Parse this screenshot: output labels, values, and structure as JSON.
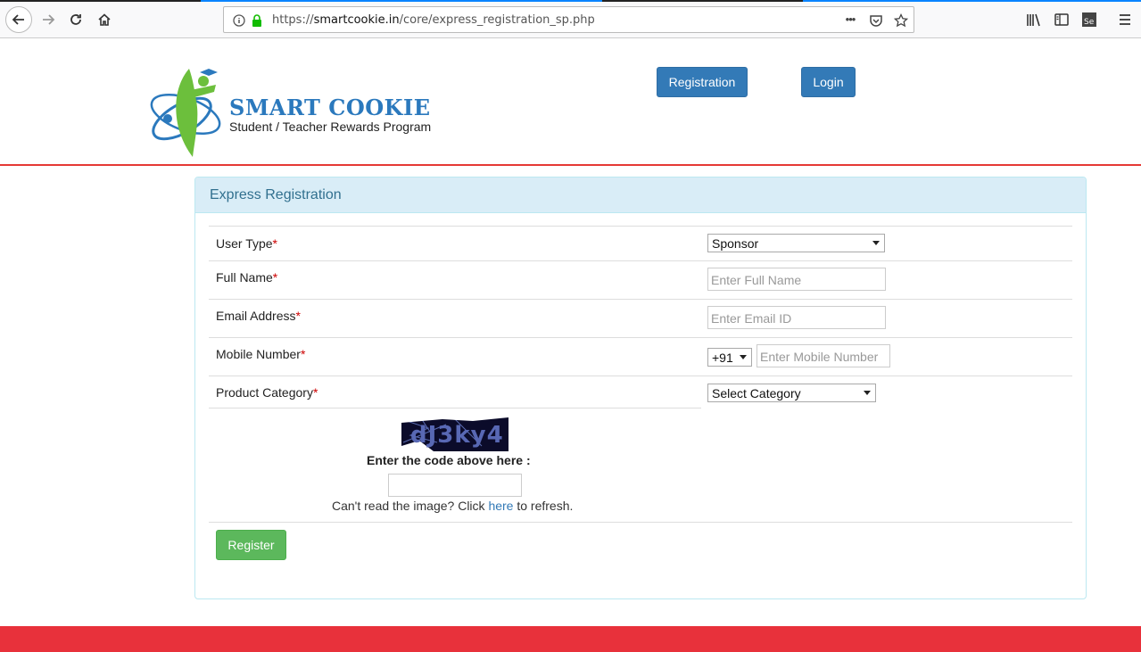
{
  "browser": {
    "url_prefix": "https://",
    "url_host": "smartcookie.in",
    "url_path": "/core/express_registration_sp.php",
    "menu_dots": "•••"
  },
  "header": {
    "brand_title": "SMART COOKIE",
    "brand_subtitle": "Student / Teacher Rewards Program",
    "registration_label": "Registration",
    "login_label": "Login"
  },
  "form": {
    "panel_title": "Express Registration",
    "fields": {
      "user_type": {
        "label": "User Type",
        "value": "Sponsor"
      },
      "full_name": {
        "label": "Full Name",
        "placeholder": "Enter Full Name"
      },
      "email": {
        "label": "Email Address",
        "placeholder": "Enter Email ID"
      },
      "mobile": {
        "label": "Mobile Number",
        "country_code": "+91",
        "placeholder": "Enter Mobile Number"
      },
      "product_category": {
        "label": "Product Category",
        "value": "Select Category"
      }
    },
    "required_mark": "*",
    "captcha": {
      "code": "dJ3ky4",
      "prompt": "Enter the code above here :",
      "help_before": "Can't read the image? Click ",
      "help_link": "here",
      "help_after": " to refresh."
    },
    "register_label": "Register"
  },
  "colors": {
    "primary": "#337ab7",
    "success": "#5cb85c",
    "accent_red": "#e8313b",
    "panel_head_bg": "#d9edf7",
    "panel_title": "#31708f"
  }
}
